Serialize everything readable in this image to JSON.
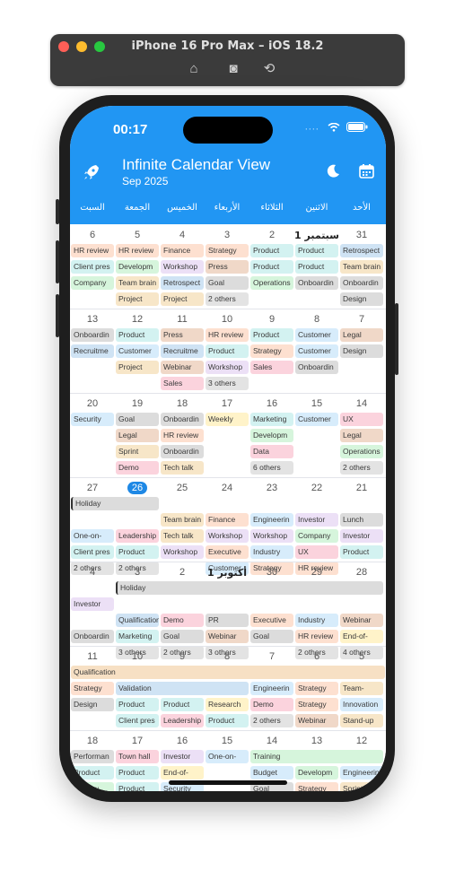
{
  "simulator": {
    "title": "iPhone 16 Pro Max – iOS 18.2",
    "icons": [
      "home-icon",
      "screenshot-icon",
      "rotate-icon"
    ]
  },
  "status": {
    "time": "00:17",
    "icons": "···· ✓ ▭"
  },
  "header": {
    "title": "Infinite Calendar View",
    "subtitle": "Sep 2025",
    "icons": [
      "rocket-icon",
      "moon-icon",
      "calendar-icon"
    ]
  },
  "weekdays": [
    "الأحد",
    "الاثنين",
    "الثلاثاء",
    "الأربعاء",
    "الخميس",
    "الجمعة",
    "السبت"
  ],
  "colors": {
    "accent": "#2196f3",
    "today": "#1e88e5"
  },
  "weeks": [
    {
      "days": [
        "31",
        "سبتمبر 1",
        "2",
        "3",
        "4",
        "5",
        "6"
      ],
      "events": [
        [
          "Retrospect",
          "Product",
          "Product",
          "Strategy",
          "Finance",
          "HR review",
          "HR review"
        ],
        [
          "Team brain",
          "Product",
          "Product",
          "Press",
          "Workshop",
          "Developm",
          "Client pres"
        ],
        [
          "Onboardin",
          "Onboardin",
          "Operations",
          "Goal",
          "Retrospect",
          "Team brain",
          "Company"
        ],
        [
          "Design",
          "",
          "",
          "2 others",
          "Project",
          "Project",
          ""
        ]
      ]
    },
    {
      "days": [
        "7",
        "8",
        "9",
        "10",
        "11",
        "12",
        "13"
      ],
      "events": [
        [
          "Legal",
          "Customer",
          "Product",
          "HR review",
          "Press",
          "Product",
          "Onboardin"
        ],
        [
          "Design",
          "Customer",
          "Strategy",
          "Product",
          "Recruitme",
          "Customer",
          "Recruitme"
        ],
        [
          "",
          "Onboardin",
          "Sales",
          "Workshop",
          "Webinar",
          "Project",
          ""
        ],
        [
          "",
          "",
          "",
          "3 others",
          "Sales",
          "",
          ""
        ]
      ]
    },
    {
      "days": [
        "14",
        "15",
        "16",
        "17",
        "18",
        "19",
        "20"
      ],
      "events": [
        [
          "UX",
          "Customer",
          "Marketing",
          "Weekly",
          "Onboardin",
          "Goal",
          "Security"
        ],
        [
          "Legal",
          "",
          "Developm",
          "",
          "HR review",
          "Legal",
          ""
        ],
        [
          "Operations",
          "",
          "Data",
          "",
          "Onboardin",
          "Sprint",
          ""
        ],
        [
          "2 others",
          "",
          "6 others",
          "",
          "Tech talk",
          "Demo",
          ""
        ]
      ]
    },
    {
      "days": [
        "21",
        "22",
        "23",
        "24",
        "25",
        "26",
        "27"
      ],
      "span": "Holiday",
      "events": [
        [
          "Lunch",
          "Investor",
          "Engineerin",
          "Finance",
          "Team brain",
          "",
          ""
        ],
        [
          "Investor",
          "Company",
          "Workshop",
          "Workshop",
          "Tech talk",
          "Leadership",
          "One-on-"
        ],
        [
          "Product",
          "UX",
          "Industry",
          "Executive",
          "Workshop",
          "Product",
          "Client pres"
        ],
        [
          "",
          "HR review",
          "Strategy",
          "Customer",
          "",
          "2 others",
          "2 others"
        ]
      ]
    },
    {
      "days": [
        "28",
        "29",
        "30",
        "أكتوبر 1",
        "2",
        "3",
        "4"
      ],
      "span": "Holiday",
      "events": [
        [
          "",
          "",
          "",
          "",
          "",
          "",
          "Investor"
        ],
        [
          "Webinar",
          "Industry",
          "Executive",
          "PR",
          "Demo",
          "Qualification",
          ""
        ],
        [
          "End-of-",
          "HR review",
          "Goal",
          "Webinar",
          "Goal",
          "Marketing",
          "Onboardin"
        ],
        [
          "4 others",
          "2 others",
          "",
          "3 others",
          "2 others",
          "3 others",
          ""
        ]
      ]
    },
    {
      "days": [
        "5",
        "6",
        "7",
        "8",
        "9",
        "10",
        "11"
      ],
      "span": "Qualification",
      "events": [
        [
          "Team-",
          "Strategy",
          "Engineerin",
          "Validation",
          "",
          "",
          "Strategy"
        ],
        [
          "Innovation",
          "Strategy",
          "Demo",
          "Research",
          "Product",
          "Product",
          "Design"
        ],
        [
          "Stand-up",
          "Webinar",
          "2 others",
          "Product",
          "Leadership",
          "Client pres",
          ""
        ]
      ]
    },
    {
      "days": [
        "12",
        "13",
        "14",
        "15",
        "16",
        "17",
        "18"
      ],
      "events": [
        [
          "",
          "",
          "Training",
          "One-on-",
          "Investor",
          "Town hall",
          "Performan"
        ],
        [
          "Engineerin",
          "Developm",
          "Budget",
          "",
          "End-of-",
          "Product",
          "Product"
        ],
        [
          "Sprint",
          "Strategy",
          "Goal",
          "",
          "Security",
          "Product",
          "Review"
        ]
      ]
    }
  ]
}
